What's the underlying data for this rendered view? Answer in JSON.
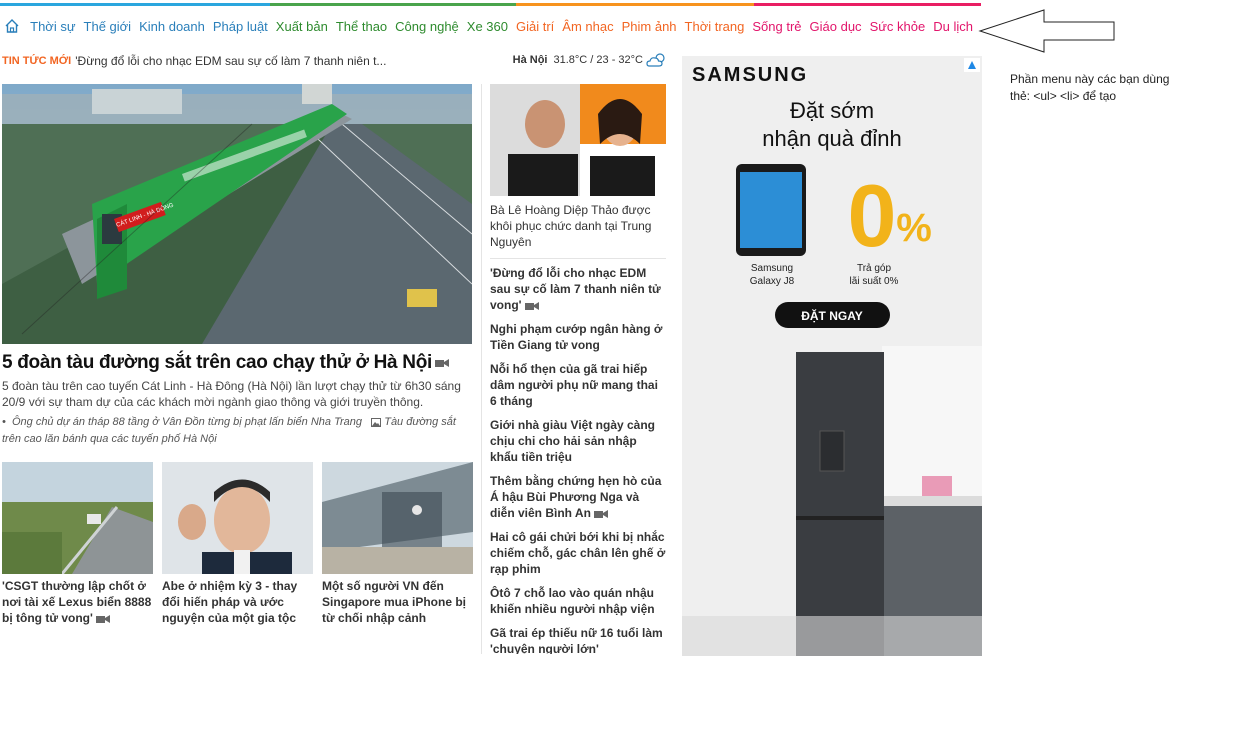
{
  "strip_colors": [
    "#2aa6de",
    "#4aa44c",
    "#f7931e",
    "#e91e63"
  ],
  "nav": {
    "home_icon": "home-icon",
    "items": [
      {
        "label": "Thời sự",
        "color": "#2a7fba"
      },
      {
        "label": "Thế giới",
        "color": "#2a7fba"
      },
      {
        "label": "Kinh doanh",
        "color": "#2a7fba"
      },
      {
        "label": "Pháp luật",
        "color": "#2a7fba"
      },
      {
        "label": "Xuất bản",
        "color": "#2e8b2e"
      },
      {
        "label": "Thể thao",
        "color": "#2e8b2e"
      },
      {
        "label": "Công nghệ",
        "color": "#2e8b2e"
      },
      {
        "label": "Xe 360",
        "color": "#2e8b2e"
      },
      {
        "label": "Giải trí",
        "color": "#f26522"
      },
      {
        "label": "Âm nhạc",
        "color": "#f26522"
      },
      {
        "label": "Phim ảnh",
        "color": "#f26522"
      },
      {
        "label": "Thời trang",
        "color": "#f26522"
      },
      {
        "label": "Sống trẻ",
        "color": "#e2156b"
      },
      {
        "label": "Giáo dục",
        "color": "#e2156b"
      },
      {
        "label": "Sức khỏe",
        "color": "#e2156b"
      },
      {
        "label": "Du lịch",
        "color": "#e2156b"
      }
    ]
  },
  "annotation": {
    "note": "Phần menu này các bạn dùng thẻ: <ul> <li> để tạo"
  },
  "ticker": {
    "label": "TIN TỨC MỚI",
    "headline": "'Đừng đổ lỗi cho nhạc EDM sau sự cố làm 7 thanh niên t...",
    "city": "Hà Nội",
    "temp": "31.8°C / 23 - 32°C",
    "weather_icon": "cloud-sun-icon"
  },
  "hero": {
    "title": "5 đoàn tàu đường sắt trên cao chạy thử ở Hà Nội",
    "desc": "5 đoàn tàu trên cao tuyến Cát Linh - Hà Đông (Hà Nội) lần lượt chạy thử từ 6h30 sáng 20/9 với sự tham dự của các khách mời ngành giao thông và giới truyền thông.",
    "related_1": "Ông chủ dự án tháp 88 tầng ở Vân Đồn từng bị phạt lấn biển Nha Trang",
    "related_2": "Tàu đường sắt trên cao lăn bánh qua các tuyến phố Hà Nội",
    "train_banner": "CÁT LINH - HÀ ĐÔNG"
  },
  "thumbs": [
    {
      "caption": "'CSGT thường lập chốt ở nơi tài xế Lexus biển 8888 bị tông tử vong'"
    },
    {
      "caption": "Abe ở nhiệm kỳ 3 - thay đổi hiến pháp và ước nguyện của một gia tộc"
    },
    {
      "caption": "Một số người VN đến Singapore mua iPhone bị từ chối nhập cảnh"
    }
  ],
  "side": {
    "lead": "Bà Lê Hoàng Diệp Thảo được khôi phục chức danh tại Trung Nguyên",
    "items": [
      "'Đừng đổ lỗi cho nhạc EDM sau sự cố làm 7 thanh niên tử vong'",
      "Nghi phạm cướp ngân hàng ở Tiền Giang tử vong",
      "Nỗi hổ thẹn của gã trai hiếp dâm người phụ nữ mang thai 6 tháng",
      "Giới nhà giàu Việt ngày càng chịu chi cho hải sản nhập khẩu tiền triệu",
      "Thêm bằng chứng hẹn hò của Á hậu Bùi Phương Nga và diễn viên Bình An",
      "Hai cô gái chửi bới khi bị nhắc chiếm chỗ, gác chân lên ghế ở rạp phim",
      "Ôtô 7 chỗ lao vào quán nhậu khiến nhiều người nhập viện",
      "Gã trai ép thiếu nữ 16 tuổi làm 'chuyện người lớn'"
    ]
  },
  "ad": {
    "brand": "SAMSUNG",
    "headline_1": "Đặt sớm",
    "headline_2": "nhận quà đỉnh",
    "phone_label_1": "Samsung",
    "phone_label_2": "Galaxy J8",
    "zero": "0",
    "pct": "%",
    "offer_label_1": "Trả góp",
    "offer_label_2": "lãi suất 0%",
    "cta": "ĐẶT NGAY",
    "adchoice_icon": "adchoices-icon"
  }
}
